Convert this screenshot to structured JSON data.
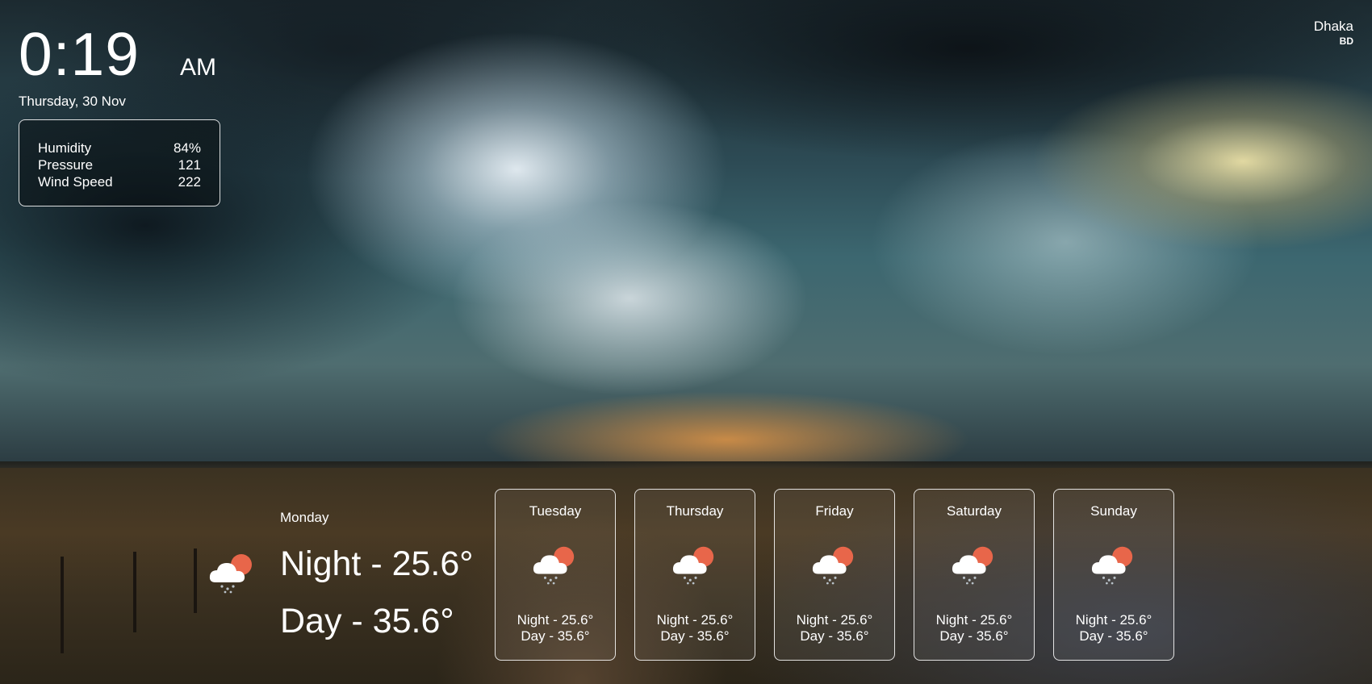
{
  "clock": {
    "time": "0:19",
    "period": "AM",
    "date": "Thursday, 30 Nov"
  },
  "location": {
    "city": "Dhaka",
    "country": "BD"
  },
  "stats": [
    {
      "label": "Humidity",
      "value": "84%"
    },
    {
      "label": "Pressure",
      "value": "121"
    },
    {
      "label": "Wind Speed",
      "value": "222"
    }
  ],
  "today": {
    "day": "Monday",
    "night": "Night - 25.6°",
    "daytime": "Day - 35.6°",
    "icon": "cloud-sun-rain-icon"
  },
  "forecast": [
    {
      "day": "Tuesday",
      "night": "Night - 25.6°",
      "daytime": "Day - 35.6°",
      "icon": "cloud-sun-rain-icon"
    },
    {
      "day": "Thursday",
      "night": "Night - 25.6°",
      "daytime": "Day - 35.6°",
      "icon": "cloud-sun-rain-icon"
    },
    {
      "day": "Friday",
      "night": "Night - 25.6°",
      "daytime": "Day - 35.6°",
      "icon": "cloud-sun-rain-icon"
    },
    {
      "day": "Saturday",
      "night": "Night - 25.6°",
      "daytime": "Day - 35.6°",
      "icon": "cloud-sun-rain-icon"
    },
    {
      "day": "Sunday",
      "night": "Night - 25.6°",
      "daytime": "Day - 35.6°",
      "icon": "cloud-sun-rain-icon"
    }
  ],
  "colors": {
    "sun": "#e8664a",
    "cloud": "#ffffff",
    "rain": "#b9c2c9"
  }
}
